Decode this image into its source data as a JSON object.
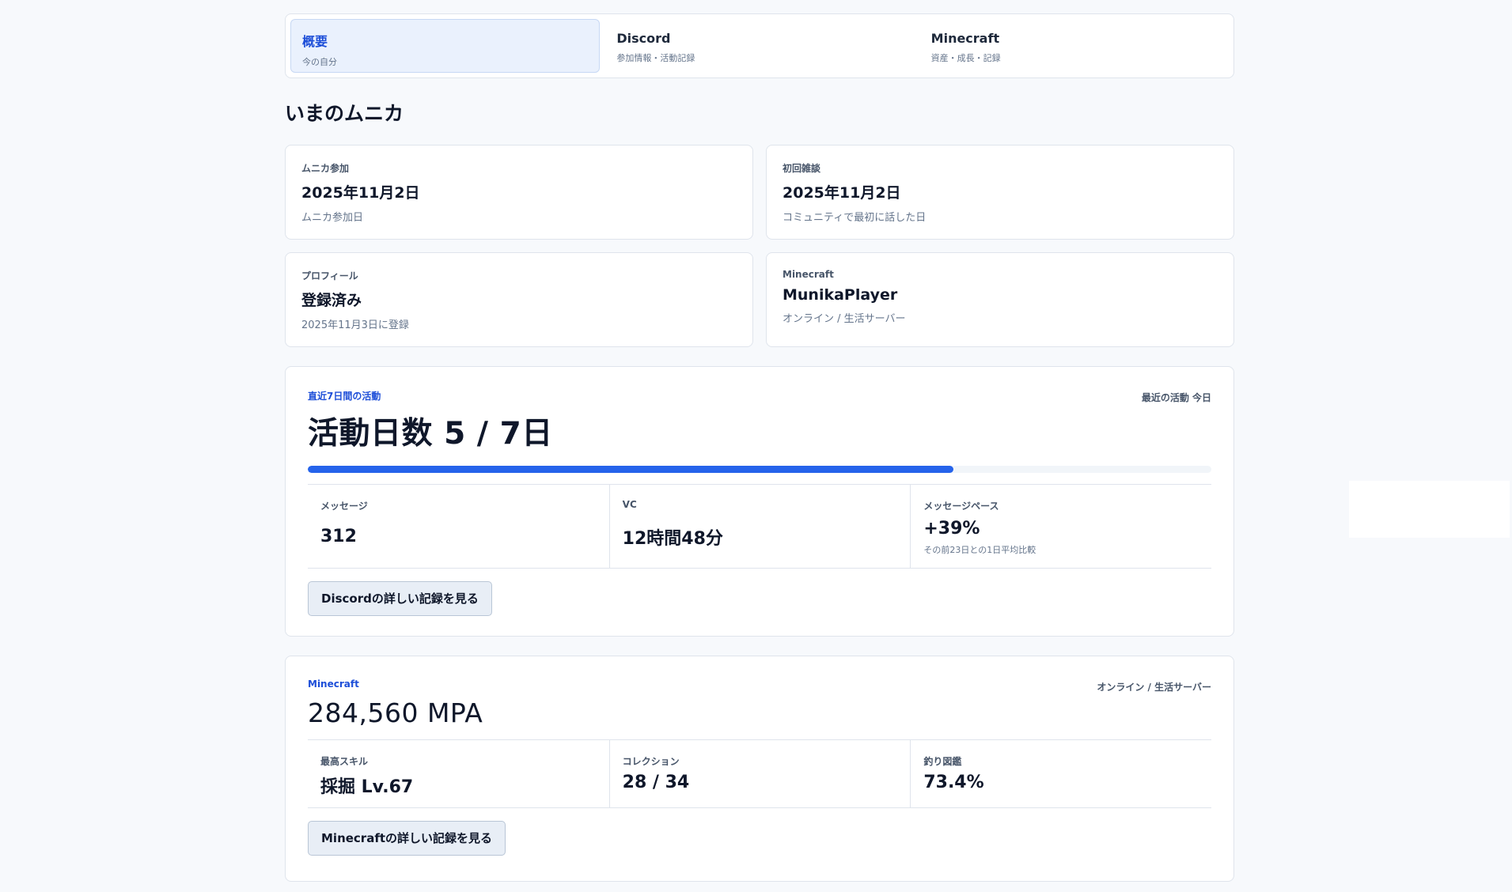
{
  "tabs": [
    {
      "title": "概要",
      "sub": "今の自分"
    },
    {
      "title": "Discord",
      "sub": "参加情報・活動記録"
    },
    {
      "title": "Minecraft",
      "sub": "資産・成長・記録"
    }
  ],
  "section_title": "いまのムニカ",
  "cards": [
    {
      "label": "ムニカ参加",
      "value": "2025年11月2日",
      "sub": "ムニカ参加日"
    },
    {
      "label": "初回雑談",
      "value": "2025年11月2日",
      "sub": "コミュニティで最初に話した日"
    },
    {
      "label": "プロフィール",
      "value": "登録済み",
      "sub": "2025年11月3日に登録"
    },
    {
      "label": "Minecraft",
      "value": "MunikaPlayer",
      "sub": "オンライン / 生活サーバー"
    }
  ],
  "activity": {
    "kicker": "直近7日間の活動",
    "recent": "最近の活動 今日",
    "headline": "活動日数 5 / 7日",
    "active_days": 5,
    "total_days": 7,
    "stats": [
      {
        "label": "メッセージ",
        "value": "312"
      },
      {
        "label": "VC",
        "value": "12時間48分"
      },
      {
        "label": "メッセージペース",
        "value": "+39%",
        "note": "その前23日との1日平均比較"
      }
    ],
    "button": "Discordの詳しい記録を見る"
  },
  "minecraft": {
    "kicker": "Minecraft",
    "status": "オンライン / 生活サーバー",
    "headline": "284,560 MPA",
    "stats": [
      {
        "label": "最高スキル",
        "value": "採掘 Lv.67"
      },
      {
        "label": "コレクション",
        "value": "28 / 34"
      },
      {
        "label": "釣り図鑑",
        "value": "73.4%"
      }
    ],
    "button": "Minecraftの詳しい記録を見る"
  }
}
